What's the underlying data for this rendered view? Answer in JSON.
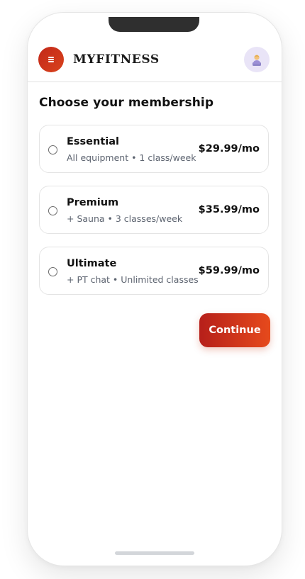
{
  "header": {
    "brand": "MYFITNESS",
    "menu_icon": "hamburger-icon",
    "avatar_icon": "user-avatar-icon"
  },
  "page": {
    "title": "Choose your membership"
  },
  "plans": [
    {
      "name": "Essential",
      "description": "All equipment • 1 class/week",
      "price": "$29.99/mo",
      "selected": false
    },
    {
      "name": "Premium",
      "description": "+ Sauna • 3 classes/week",
      "price": "$35.99/mo",
      "selected": false
    },
    {
      "name": "Ultimate",
      "description": "+ PT chat • Unlimited classes",
      "price": "$59.99/mo",
      "selected": false
    }
  ],
  "actions": {
    "continue_label": "Continue"
  },
  "colors": {
    "accent_start": "#b61f1a",
    "accent_end": "#e64a1c",
    "avatar_bg": "#e9e4f7"
  }
}
